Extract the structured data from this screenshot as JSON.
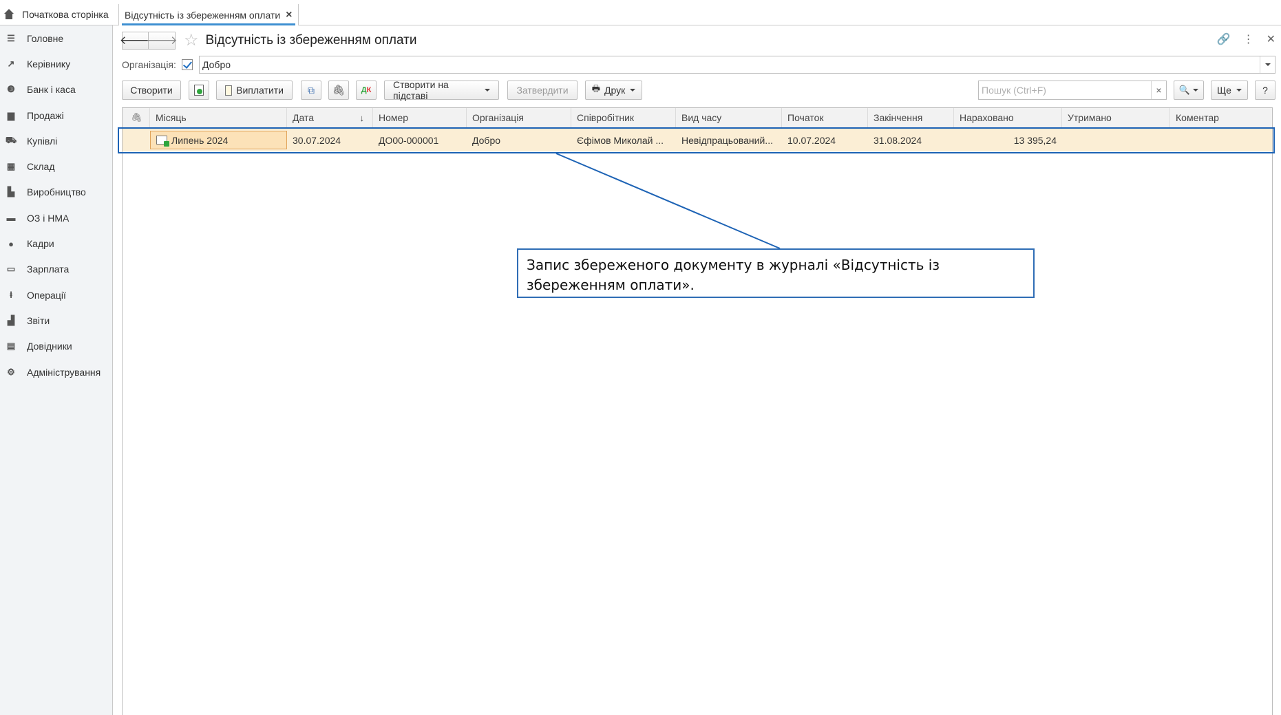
{
  "tabs": {
    "home_label": "Початкова сторінка",
    "active_label": "Відсутність із збереженням оплати"
  },
  "sidebar": {
    "items": [
      {
        "label": "Головне",
        "icon": "menu-icon"
      },
      {
        "label": "Керівнику",
        "icon": "trend-icon"
      },
      {
        "label": "Банк і каса",
        "icon": "coin-icon"
      },
      {
        "label": "Продажі",
        "icon": "bag-icon"
      },
      {
        "label": "Купівлі",
        "icon": "cart-icon"
      },
      {
        "label": "Склад",
        "icon": "warehouse-icon"
      },
      {
        "label": "Виробництво",
        "icon": "factory-icon"
      },
      {
        "label": "ОЗ і НМА",
        "icon": "truck-icon"
      },
      {
        "label": "Кадри",
        "icon": "person-icon"
      },
      {
        "label": "Зарплата",
        "icon": "card-icon"
      },
      {
        "label": "Операції",
        "icon": "dtkt-icon"
      },
      {
        "label": "Звіти",
        "icon": "bar-chart-icon"
      },
      {
        "label": "Довідники",
        "icon": "books-icon"
      },
      {
        "label": "Адміністрування",
        "icon": "gear-icon"
      }
    ]
  },
  "header": {
    "title": "Відсутність із збереженням оплати"
  },
  "filter": {
    "org_label": "Організація:",
    "org_checked": true,
    "org_value": "Добро"
  },
  "toolbar": {
    "create_label": "Створити",
    "pay_label": "Виплатити",
    "create_based_label": "Створити на підставі",
    "approve_label": "Затвердити",
    "print_label": "Друк",
    "search_placeholder": "Пошук (Ctrl+F)",
    "more_label": "Ще",
    "help_label": "?"
  },
  "table": {
    "columns": [
      "Місяць",
      "Дата",
      "Номер",
      "Організація",
      "Співробітник",
      "Вид часу",
      "Початок",
      "Закінчення",
      "Нараховано",
      "Утримано",
      "Коментар"
    ],
    "rows": [
      {
        "month": "Липень 2024",
        "date": "30.07.2024",
        "number": "ДО00-000001",
        "organization": "Добро",
        "employee": "Єфімов Миколай ...",
        "time_type": "Невідпрацьований...",
        "start": "10.07.2024",
        "end": "31.08.2024",
        "accrued": "13 395,24",
        "withheld": "",
        "comment": ""
      }
    ]
  },
  "callout": {
    "text": "Запис збереженого документу в журналі «Відсутність із збереженням оплати»."
  },
  "colors": {
    "accent": "#3d8fd1",
    "selected_row": "#fbeed5",
    "frame": "#1d63b5"
  }
}
